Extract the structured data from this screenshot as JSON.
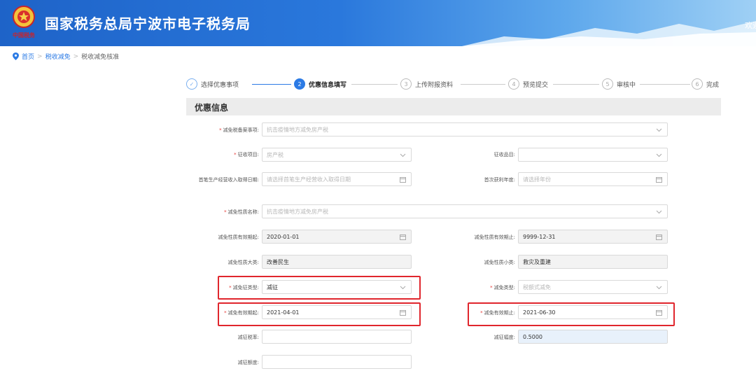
{
  "header": {
    "title": "国家税务总局宁波市电子税务局",
    "welcome": "欢迎"
  },
  "breadcrumb": {
    "home": "首页",
    "level1": "税收减免",
    "current": "税收减免核准",
    "separator": ">"
  },
  "steps": [
    {
      "num": "✓",
      "label": "选择优惠事项"
    },
    {
      "num": "2",
      "label": "优惠信息填写"
    },
    {
      "num": "3",
      "label": "上传附报资料"
    },
    {
      "num": "4",
      "label": "预览提交"
    },
    {
      "num": "5",
      "label": "审核中"
    },
    {
      "num": "6",
      "label": "完成"
    }
  ],
  "section_title": "优惠信息",
  "form": {
    "jmsbasx_label": "减免税备案事项:",
    "jmsbasx_placeholder": "抗击疫情地方减免房产税",
    "zsxm_label": "征收项目:",
    "zsxm_placeholder": "房产税",
    "zspm_label": "征收品目:",
    "scsj_label": "首笔生产经营收入取得日期:",
    "scsj_placeholder": "请选择首笔生产经营收入取得日期",
    "hlnd_label": "首次获利年度:",
    "hlnd_placeholder": "请选择年份",
    "jmxzmc_label": "减免性质名称:",
    "jmxzmc_placeholder": "抗击疫情地方减免房产税",
    "yxqq_label": "减免性质有效期起:",
    "yxqq_value": "2020-01-01",
    "yxqz_label": "减免性质有效期止:",
    "yxqz_value": "9999-12-31",
    "dl_label": "减免性质大类:",
    "dl_value": "改善民生",
    "xl_label": "减免性质小类:",
    "xl_value": "救灾及重建",
    "jzlx_label": "减免征类型:",
    "jzlx_value": "减征",
    "jmlx_label": "减免类型:",
    "jmlx_placeholder": "税额式减免",
    "jmqq_label": "减免有效期起:",
    "jmqq_value": "2021-04-01",
    "jmqz_label": "减免有效期止:",
    "jmqz_value": "2021-06-30",
    "jzsl_label": "减征税率:",
    "jzfd_label": "减征幅度:",
    "jzfd_value": "0.5000",
    "jzed_label": "减征额度:",
    "required_mark": "*"
  },
  "colors": {
    "primary": "#2c7be5",
    "highlight_border": "#e0262d",
    "header_start": "#1e63c8"
  }
}
